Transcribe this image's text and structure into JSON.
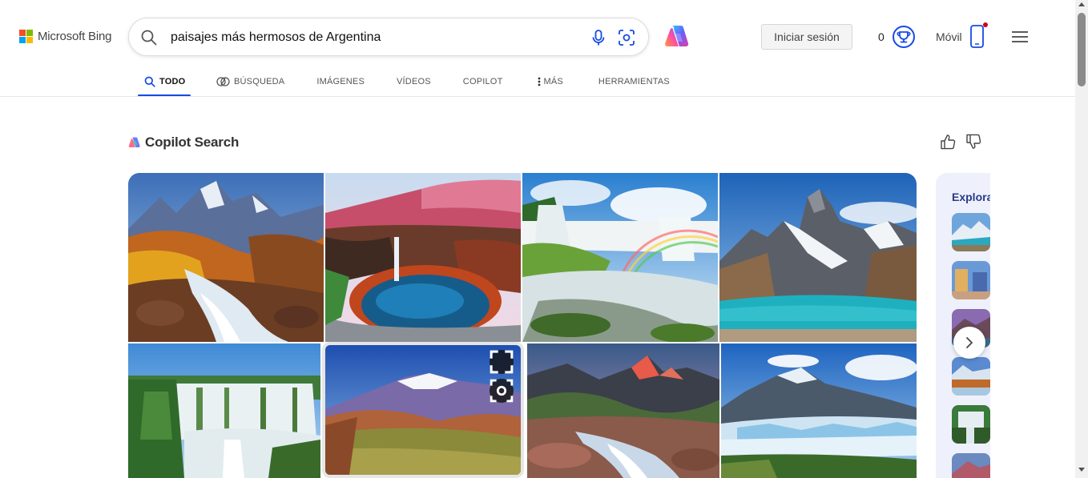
{
  "brand": {
    "logo_text": "Microsoft Bing",
    "colors": [
      "#f25022",
      "#7fba00",
      "#00a4ef",
      "#ffb900"
    ]
  },
  "search": {
    "query": "paisajes más hermosos de Argentina"
  },
  "header": {
    "signin_label": "Iniciar sesión",
    "rewards_count": "0",
    "mobile_label": "Móvil"
  },
  "tabs": [
    {
      "label": "TODO",
      "icon": "search-icon",
      "active": true
    },
    {
      "label": "BÚSQUEDA",
      "icon": "copilot-search-icon",
      "active": false
    },
    {
      "label": "IMÁGENES",
      "active": false
    },
    {
      "label": "VÍDEOS",
      "active": false
    },
    {
      "label": "COPILOT",
      "active": false
    },
    {
      "label": "MÁS",
      "icon": "more-vertical-icon",
      "active": false
    },
    {
      "label": "HERRAMIENTAS",
      "active": false
    }
  ],
  "copilot_search": {
    "title": "Copilot Search"
  },
  "explore": {
    "title": "Explora"
  },
  "colors": {
    "accent": "#174ae4",
    "explore_bg": "#eef1fb",
    "notification_dot": "#d0021b"
  }
}
